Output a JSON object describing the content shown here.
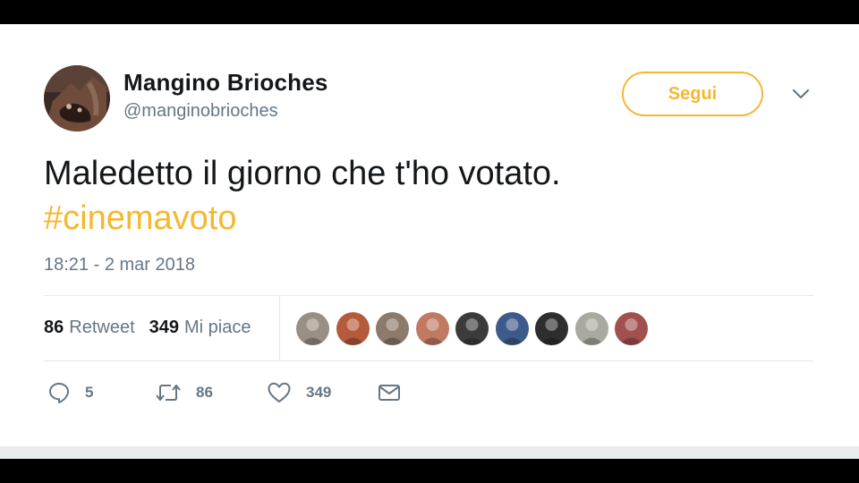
{
  "user": {
    "display_name": "Mangino Brioches",
    "handle": "@manginobrioches",
    "avatar_icon": "profile-photo-feet"
  },
  "follow_button": {
    "label": "Segui"
  },
  "tweet": {
    "text": "Maledetto il giorno che t'ho votato.",
    "hashtag": "#cinemavoto",
    "timestamp": "18:21 - 2 mar 2018"
  },
  "stats": {
    "retweets": {
      "count": "86",
      "label": "Retweet"
    },
    "likes": {
      "count": "349",
      "label": "Mi piace"
    }
  },
  "likers": [
    {
      "name": "liker-avatar-1",
      "color": "#9a8f85"
    },
    {
      "name": "liker-avatar-2",
      "color": "#b65a3c"
    },
    {
      "name": "liker-avatar-3",
      "color": "#8c7a6b"
    },
    {
      "name": "liker-avatar-4",
      "color": "#c07a64"
    },
    {
      "name": "liker-avatar-5",
      "color": "#3b3b3b"
    },
    {
      "name": "liker-avatar-6",
      "color": "#3d5a8a"
    },
    {
      "name": "liker-avatar-7",
      "color": "#2e2e2e"
    },
    {
      "name": "liker-avatar-8",
      "color": "#a9a9a0"
    },
    {
      "name": "liker-avatar-9",
      "color": "#a24f4f"
    }
  ],
  "actions": {
    "reply": {
      "count": "5",
      "icon": "reply-icon"
    },
    "retweet": {
      "count": "86",
      "icon": "retweet-icon"
    },
    "like": {
      "count": "349",
      "icon": "heart-icon"
    },
    "dm": {
      "icon": "envelope-icon"
    }
  },
  "colors": {
    "accent": "#f5b82e",
    "text": "#14171a",
    "secondary": "#657786"
  }
}
